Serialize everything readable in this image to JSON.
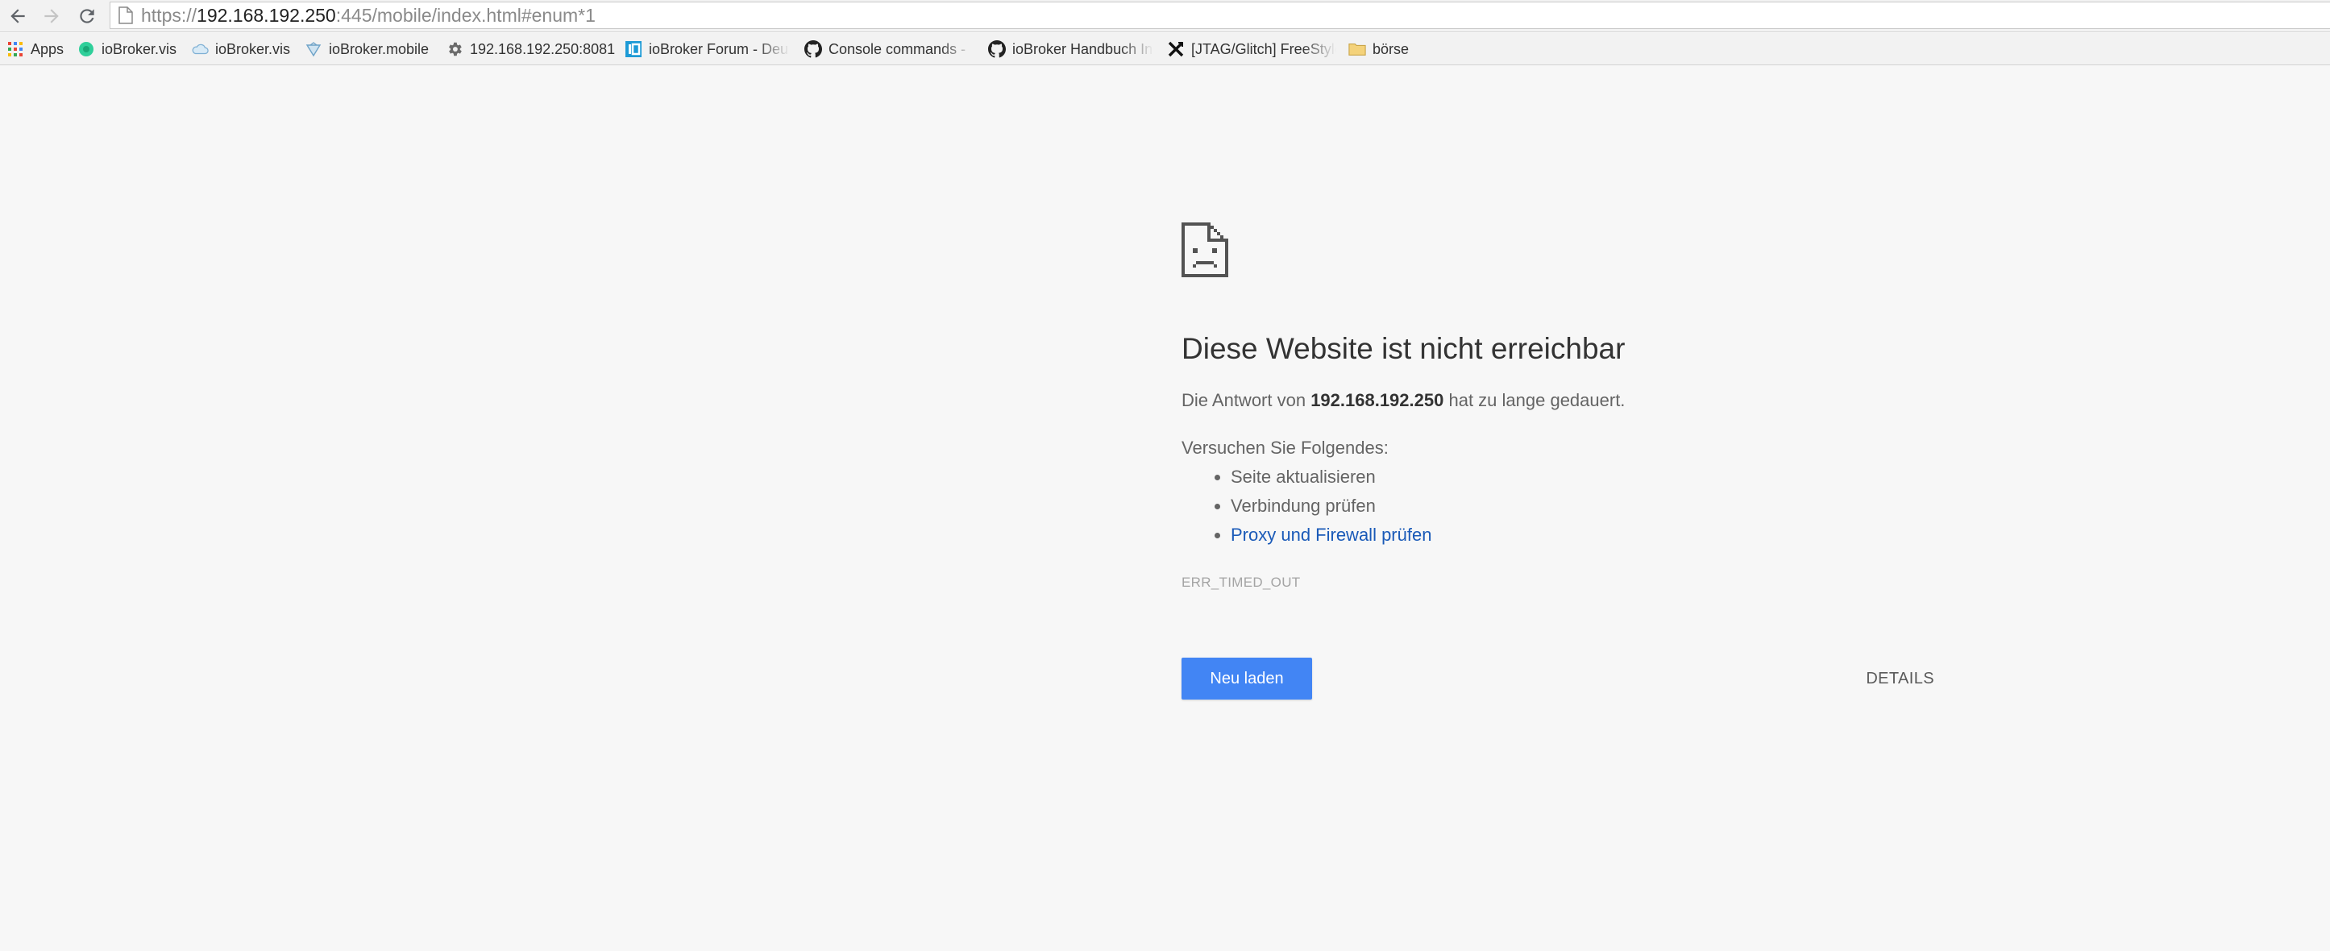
{
  "browser": {
    "nav": {
      "back_icon": "arrow-left-icon",
      "forward_icon": "arrow-right-icon",
      "reload_icon": "reload-icon"
    },
    "address_bar": {
      "scheme": "https://",
      "host": "192.168.192.250",
      "rest": ":445/mobile/index.html#enum*1"
    },
    "bookmarks": [
      {
        "label": "Apps",
        "icon": "apps-grid-icon"
      },
      {
        "label": "ioBroker.vis",
        "icon": "iobroker-vis-green-icon"
      },
      {
        "label": "ioBroker.vis",
        "icon": "iobroker-vis-cloud-icon"
      },
      {
        "label": "ioBroker.mobile",
        "icon": "iobroker-mobile-icon"
      },
      {
        "label": "192.168.192.250:8081",
        "icon": "gear-icon"
      },
      {
        "label": "ioBroker Forum - Deu",
        "icon": "iobroker-forum-icon"
      },
      {
        "label": "Console commands -",
        "icon": "github-icon"
      },
      {
        "label": "ioBroker Handbuch In",
        "icon": "github-icon"
      },
      {
        "label": "[JTAG/Glitch] FreeStyle",
        "icon": "jtag-icon"
      },
      {
        "label": "börse",
        "icon": "folder-icon"
      }
    ]
  },
  "error": {
    "icon": "sad-page-icon",
    "title": "Diese Website ist nicht erreichbar",
    "desc_prefix": "Die Antwort von ",
    "desc_host": "192.168.192.250",
    "desc_suffix": " hat zu lange gedauert.",
    "suggestions_heading": "Versuchen Sie Folgendes:",
    "suggestions": [
      "Seite aktualisieren",
      "Verbindung prüfen",
      "Proxy und Firewall prüfen"
    ],
    "code": "ERR_TIMED_OUT",
    "reload_label": "Neu laden",
    "details_label": "DETAILS"
  },
  "colors": {
    "page_bg": "#f7f7f7",
    "primary_button": "#4285f4",
    "link": "#1a5ab8"
  }
}
